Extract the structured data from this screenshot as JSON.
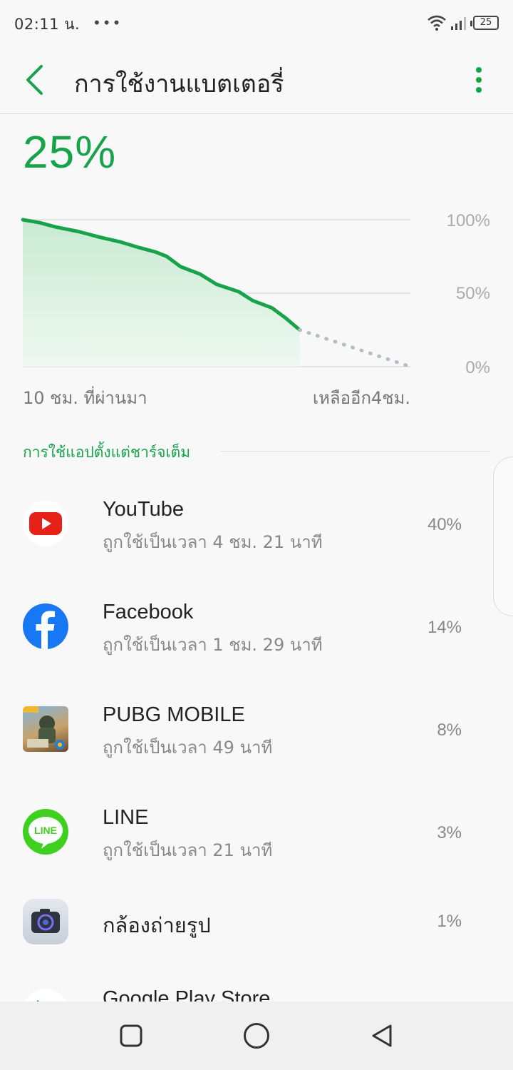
{
  "status_bar": {
    "time": "02:11 น.",
    "dots": "•••",
    "battery_number": "25",
    "icons": [
      "wifi-icon",
      "signal-icon",
      "battery-icon"
    ]
  },
  "app_bar": {
    "title": "การใช้งานแบตเตอรี่",
    "back_icon": "chevron-left-icon",
    "menu_icon": "more-vertical-icon"
  },
  "battery": {
    "level": "25%"
  },
  "chart_data": {
    "type": "line",
    "title": "",
    "xlabel": "",
    "ylabel": "",
    "ylim": [
      0,
      100
    ],
    "y_ticks": [
      "100%",
      "50%",
      "0%"
    ],
    "x_label_left": "10 ชม. ที่ผ่านมา",
    "x_label_right": "เหลืออีก4ชม.",
    "x_range_hours": [
      -10,
      4
    ],
    "series": [
      {
        "style": "solid",
        "color": "#16a34a",
        "fill": "#d6f0dc",
        "x": [
          -10,
          -9.4,
          -8.8,
          -8.0,
          -7.2,
          -6.5,
          -5.8,
          -5.2,
          -4.8,
          -4.3,
          -3.6,
          -3.0,
          -2.2,
          -1.7,
          -1.0,
          -0.5,
          0
        ],
        "y": [
          100,
          98,
          95,
          92,
          88,
          85,
          81,
          78,
          75,
          68,
          63,
          56,
          51,
          45,
          40,
          33,
          25
        ]
      },
      {
        "style": "dotted",
        "color": "#b0bec5",
        "x": [
          0,
          4
        ],
        "y": [
          25,
          0
        ]
      }
    ],
    "grid": true
  },
  "section": {
    "header": "การใช้แอปตั้งแต่ชาร์จเต็ม"
  },
  "apps": [
    {
      "name": "YouTube",
      "usage": "ถูกใช้เป็นเวลา 4 ชม. 21 นาที",
      "percent": "40%",
      "icon": "youtube-icon"
    },
    {
      "name": "Facebook",
      "usage": "ถูกใช้เป็นเวลา 1 ชม. 29 นาที",
      "percent": "14%",
      "icon": "facebook-icon"
    },
    {
      "name": "PUBG MOBILE",
      "usage": "ถูกใช้เป็นเวลา 49 นาที",
      "percent": "8%",
      "icon": "pubg-icon"
    },
    {
      "name": "LINE",
      "usage": "ถูกใช้เป็นเวลา 21 นาที",
      "percent": "3%",
      "icon": "line-icon",
      "icon_text": "LINE"
    },
    {
      "name": "กล้องถ่ายรูป",
      "usage": "",
      "percent": "1%",
      "icon": "camera-icon"
    },
    {
      "name": "Google Play Store",
      "usage": "",
      "percent": "",
      "icon": "play-store-icon"
    }
  ],
  "nav_bar": {
    "buttons": [
      "recents-square-icon",
      "home-circle-icon",
      "back-triangle-icon"
    ]
  },
  "colors": {
    "accent": "#16a34a",
    "youtube": "#e62117",
    "facebook": "#1877f2",
    "line": "#3fcf1e"
  }
}
